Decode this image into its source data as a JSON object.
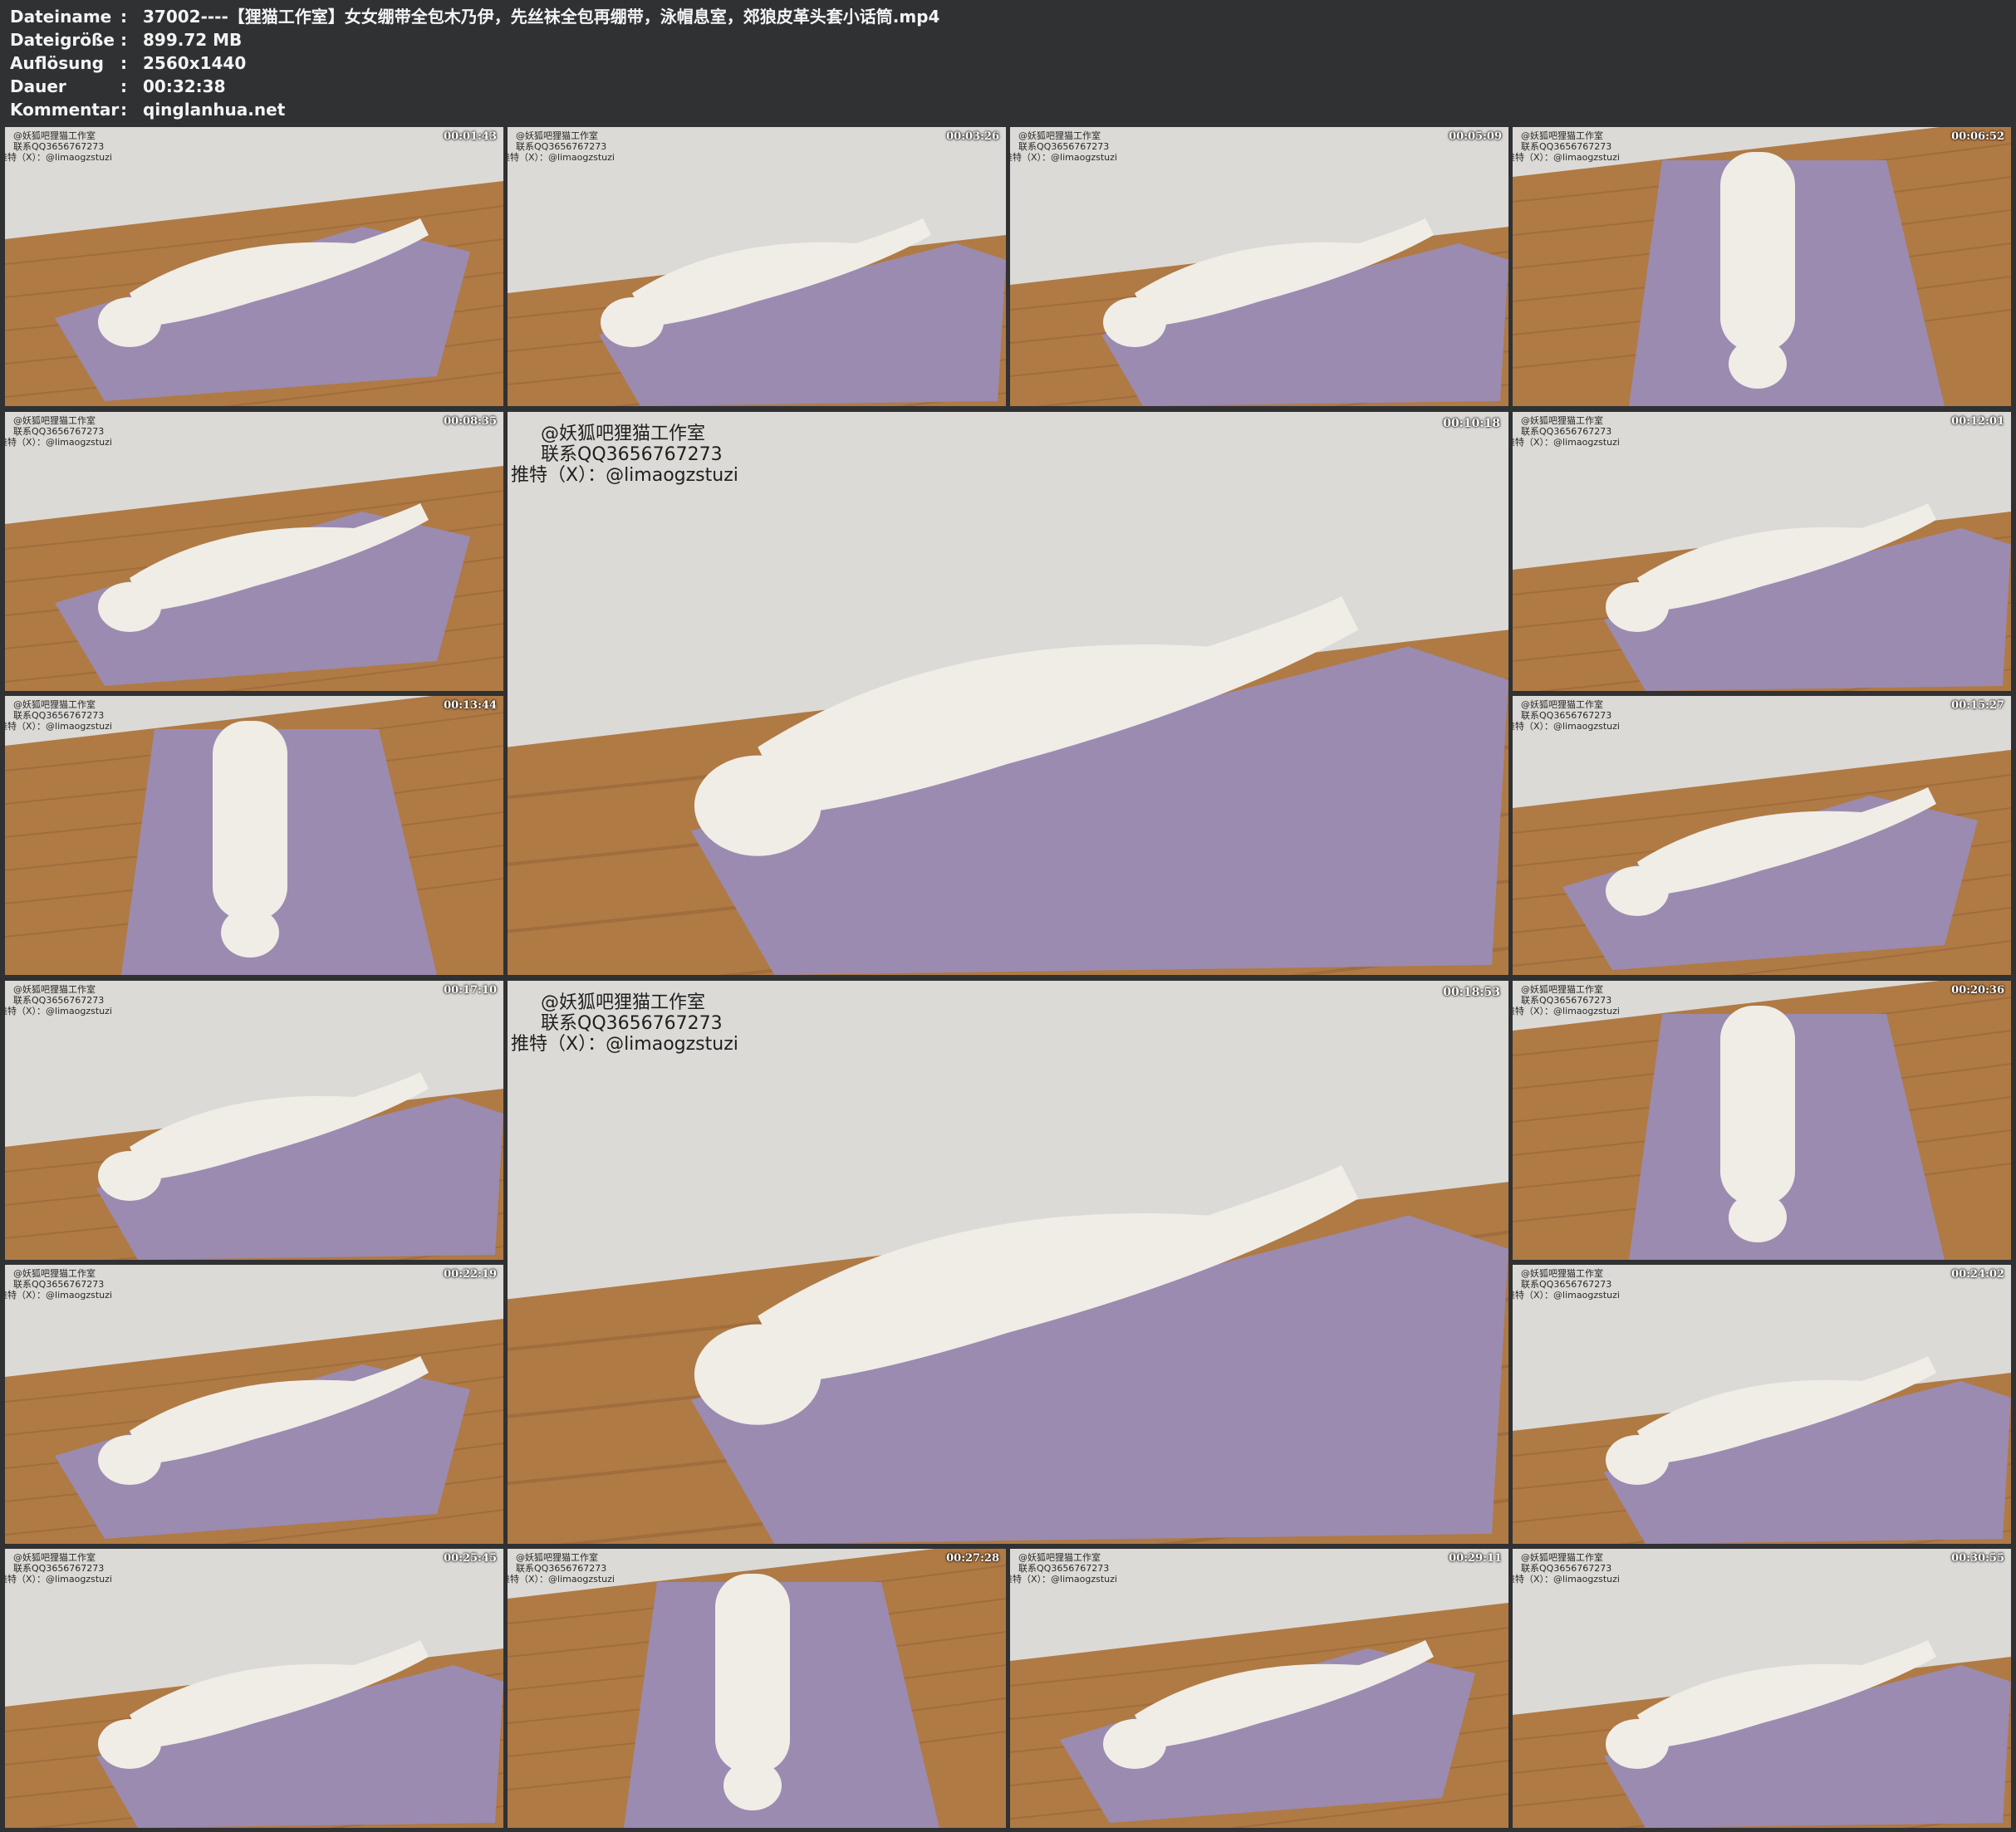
{
  "info": [
    {
      "label": "Dateiname",
      "value": "37002----【狸猫工作室】女女绷带全包木乃伊，先丝袜全包再绷带，泳帽息室，郊狼皮革头套小话筒.mp4"
    },
    {
      "label": "Dateigröße",
      "value": "899.72 MB"
    },
    {
      "label": "Auflösung",
      "value": "2560x1440"
    },
    {
      "label": "Dauer",
      "value": "00:32:38"
    },
    {
      "label": "Kommentar",
      "value": "qinglanhua.net"
    }
  ],
  "separator": ":",
  "watermark": {
    "line1": "@妖狐吧狸猫工作室",
    "line2": "联系QQ3656767273",
    "line3": "推特（X）：@limaogzstuzi"
  },
  "thumbnails": [
    {
      "time": "00:01:43"
    },
    {
      "time": "00:03:26"
    },
    {
      "time": "00:05:09"
    },
    {
      "time": "00:06:52"
    },
    {
      "time": "00:08:35"
    },
    {
      "time": "00:10:18"
    },
    {
      "time": "00:12:01"
    },
    {
      "time": "00:13:44"
    },
    {
      "time": "00:15:27"
    },
    {
      "time": "00:17:10"
    },
    {
      "time": "00:18:53"
    },
    {
      "time": "00:20:36"
    },
    {
      "time": "00:22:19"
    },
    {
      "time": "00:24:02"
    },
    {
      "time": "00:25:45"
    },
    {
      "time": "00:27:28"
    },
    {
      "time": "00:29:11"
    },
    {
      "time": "00:30:55"
    }
  ],
  "colors": {
    "background": "#2f3133",
    "wall": "#dcdad6",
    "floor": "#b07a45",
    "sheet": "#9b8bb0",
    "wrap": "#efede6"
  }
}
